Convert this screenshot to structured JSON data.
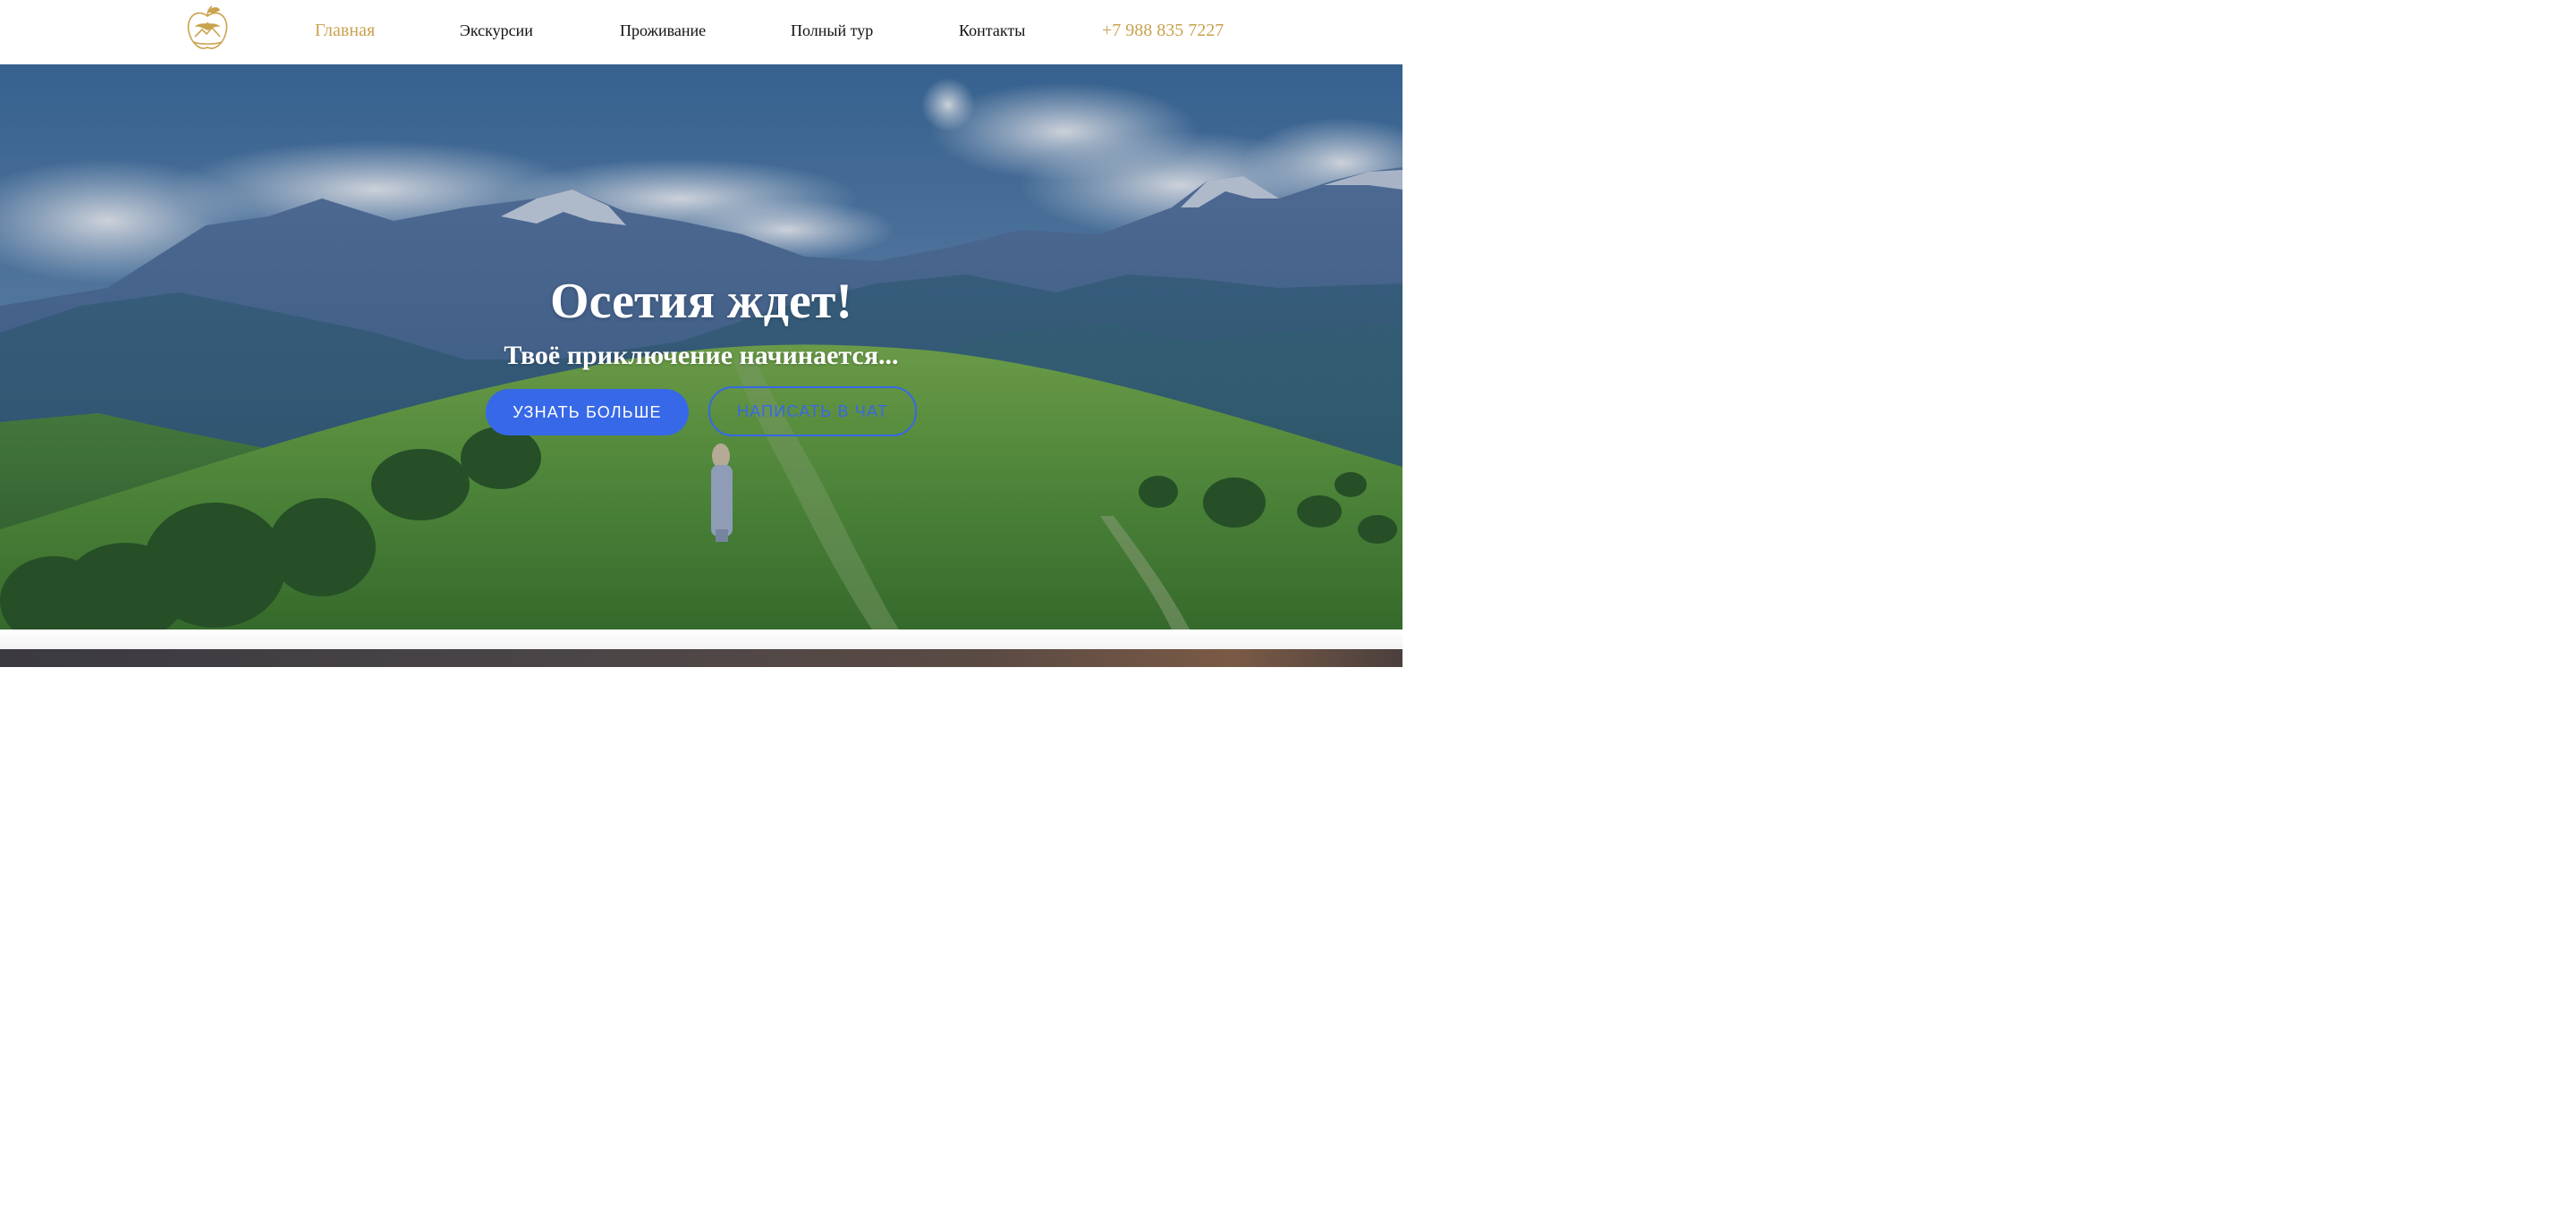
{
  "colors": {
    "accent_gold": "#C9A24E",
    "nav_text": "#111111",
    "button_blue": "#3768E8",
    "white": "#FFFFFF"
  },
  "header": {
    "logo_icon": "apple-eagle-mountain-logo-icon",
    "nav": [
      {
        "label": "Главная",
        "active": true
      },
      {
        "label": "Экскурсии",
        "active": false
      },
      {
        "label": "Проживание",
        "active": false
      },
      {
        "label": "Полный тур",
        "active": false
      },
      {
        "label": "Контакты",
        "active": false
      }
    ],
    "phone": "+7 988 835 7227"
  },
  "hero": {
    "title": "Осетия ждет!",
    "subtitle": "Твоё приключение начинается...",
    "primary_button": "УЗНАТЬ БОЛЬШЕ",
    "secondary_button": "НАПИСАТЬ В ЧАТ"
  }
}
